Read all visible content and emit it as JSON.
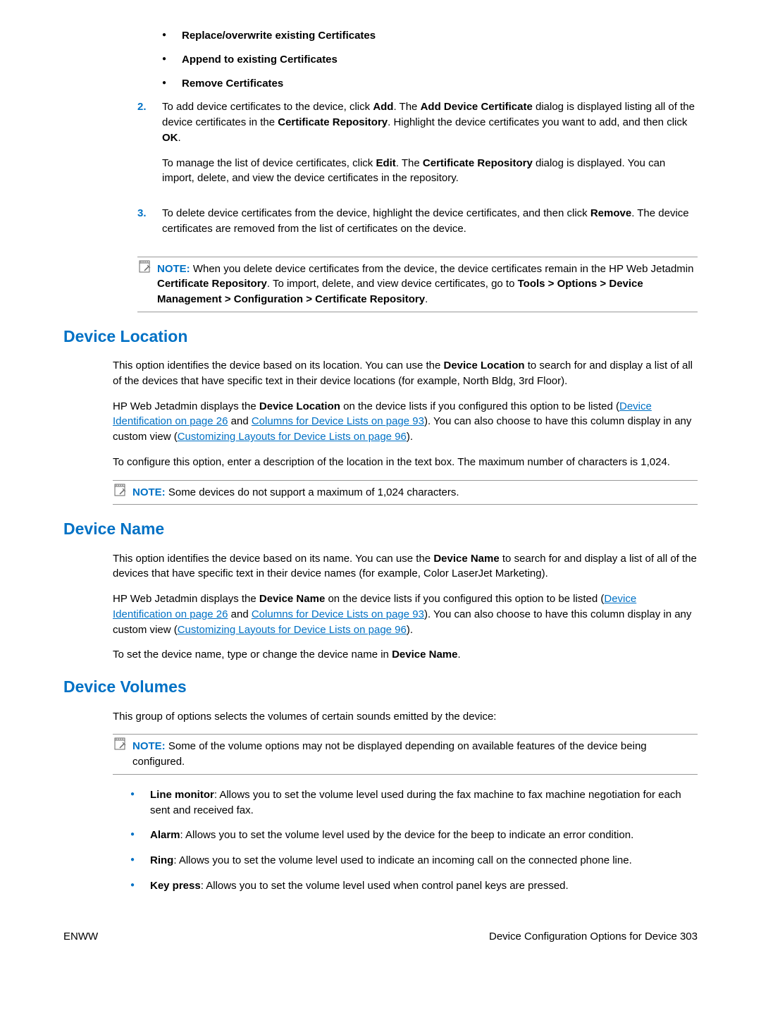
{
  "sublist": {
    "i1": "Replace/overwrite existing Certificates",
    "i2": "Append to existing Certificates",
    "i3": "Remove Certificates"
  },
  "step2": {
    "num": "2.",
    "p1a": "To add device certificates to the device, click ",
    "p1b": "Add",
    "p1c": ". The ",
    "p1d": "Add Device Certificate",
    "p1e": " dialog is displayed listing all of the device certificates in the ",
    "p1f": "Certificate Repository",
    "p1g": ". Highlight the device certificates you want to add, and then click ",
    "p1h": "OK",
    "p1i": ".",
    "p2a": "To manage the list of device certificates, click ",
    "p2b": "Edit",
    "p2c": ". The ",
    "p2d": "Certificate Repository",
    "p2e": " dialog is displayed. You can import, delete, and view the device certificates in the repository."
  },
  "step3": {
    "num": "3.",
    "p1a": "To delete device certificates from the device, highlight the device certificates, and then click ",
    "p1b": "Remove",
    "p1c": ". The device certificates are removed from the list of certificates on the device."
  },
  "note1": {
    "label": "NOTE:",
    "a": "When you delete device certificates from the device, the device certificates remain in the HP Web Jetadmin ",
    "b": "Certificate Repository",
    "c": ". To import, delete, and view device certificates, go to ",
    "d": "Tools > Options > Device Management > Configuration > Certificate Repository",
    "e": "."
  },
  "loc": {
    "heading": "Device Location",
    "p1a": "This option identifies the device based on its location. You can use the ",
    "p1b": "Device Location",
    "p1c": " to search for and display a list of all of the devices that have specific text in their device locations (for example, North Bldg, 3rd Floor).",
    "p2a": "HP Web Jetadmin displays the ",
    "p2b": "Device Location",
    "p2c": " on the device lists if you configured this option to be listed (",
    "p2d": "Device Identification on page 26",
    "p2e": " and ",
    "p2f": "Columns for Device Lists on page 93",
    "p2g": "). You can also choose to have this column display in any custom view (",
    "p2h": "Customizing Layouts for Device Lists on page 96",
    "p2i": ").",
    "p3": "To configure this option, enter a description of the location in the text box. The maximum number of characters is 1,024."
  },
  "note2": {
    "label": "NOTE:",
    "text": "Some devices do not support a maximum of 1,024 characters."
  },
  "name": {
    "heading": "Device Name",
    "p1a": "This option identifies the device based on its name. You can use the ",
    "p1b": "Device Name",
    "p1c": " to search for and display a list of all of the devices that have specific text in their device names (for example, Color LaserJet Marketing).",
    "p2a": "HP Web Jetadmin displays the ",
    "p2b": "Device Name",
    "p2c": " on the device lists if you configured this option to be listed (",
    "p2d": "Device Identification on page 26",
    "p2e": " and ",
    "p2f": "Columns for Device Lists on page 93",
    "p2g": "). You can also choose to have this column display in any custom view (",
    "p2h": "Customizing Layouts for Device Lists on page 96",
    "p2i": ").",
    "p3a": "To set the device name, type or change the device name in ",
    "p3b": "Device Name",
    "p3c": "."
  },
  "vol": {
    "heading": "Device Volumes",
    "p1": "This group of options selects the volumes of certain sounds emitted by the device:"
  },
  "note3": {
    "label": "NOTE:",
    "text": "Some of the volume options may not be displayed depending on available features of the device being configured."
  },
  "vlist": {
    "i1a": "Line monitor",
    "i1b": ": Allows you to set the volume level used during the fax machine to fax machine negotiation for each sent and received fax.",
    "i2a": "Alarm",
    "i2b": ": Allows you to set the volume level used by the device for the beep to indicate an error condition.",
    "i3a": "Ring",
    "i3b": ": Allows you to set the volume level used to indicate an incoming call on the connected phone line.",
    "i4a": "Key press",
    "i4b": ": Allows you to set the volume level used when control panel keys are pressed."
  },
  "footer": {
    "left": "ENWW",
    "right": "Device Configuration Options for Device   303"
  }
}
